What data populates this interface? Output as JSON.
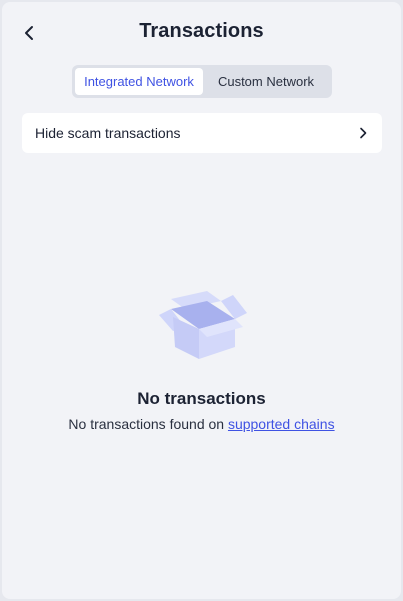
{
  "header": {
    "title": "Transactions",
    "back_icon": "chevron-left-icon"
  },
  "network_tabs": {
    "items": [
      {
        "label": "Integrated Network",
        "active": true
      },
      {
        "label": "Custom Network",
        "active": false
      }
    ]
  },
  "filter_row": {
    "label": "Hide scam transactions",
    "icon": "chevron-right-icon"
  },
  "empty_state": {
    "icon": "empty-box-icon",
    "title": "No transactions",
    "message_prefix": "No transactions found on ",
    "link_text": "supported chains"
  },
  "colors": {
    "accent": "#3f52e3",
    "background": "#f2f3f7",
    "text": "#1c2233",
    "illustration": "#c5cbf6"
  }
}
